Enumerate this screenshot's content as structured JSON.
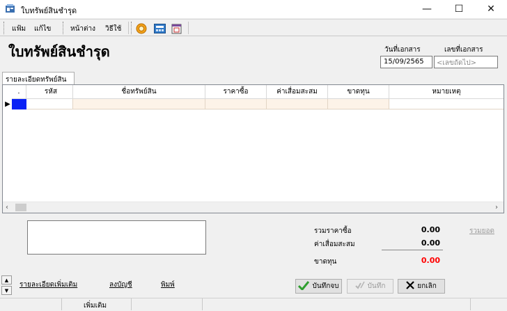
{
  "window": {
    "title": "ใบทรัพย์สินชำรุด",
    "minimize_glyph": "—",
    "maximize_glyph": "☐",
    "close_glyph": "✕"
  },
  "toolbar": {
    "menu": [
      "แฟ้ม",
      "แก้ไข",
      "หน้าต่าง",
      "วิธีใช้"
    ],
    "icons": [
      "help-disc-icon",
      "calculator-icon",
      "calendar-icon"
    ]
  },
  "header": {
    "heading": "ใบทรัพย์สินชำรุด",
    "date_label": "วันที่เอกสาร",
    "date_value": "15/09/2565",
    "docno_label": "เลขที่เอกสาร",
    "docno_placeholder": "<เลขถัดไป>"
  },
  "tab": {
    "label": "รายละเอียดทรัพย์สิน"
  },
  "grid": {
    "columns": [
      ".",
      "รหัส",
      "ชื่อทรัพย์สิน",
      "ราคาซื้อ",
      "ค่าเสื่อมสะสม",
      "ขาดทุน",
      "หมายเหตุ"
    ],
    "row_marker": "▶"
  },
  "summary": {
    "purchase_label": "รวมราคาซื้อ",
    "purchase_value": "0.00",
    "depreciation_label": "ค่าเสื่อมสะสม",
    "depreciation_value": "0.00",
    "loss_label": "ขาดทุน",
    "loss_value": "0.00",
    "total_link": "รวมยอด"
  },
  "links": {
    "more_details": "รายละเอียดเพิ่มเติม",
    "post_account": "ลงบัญชี",
    "print": "พิมพ์"
  },
  "buttons": {
    "save_close": "บันทึกจบ",
    "save": "บันทึก",
    "cancel": "ยกเลิก"
  },
  "statusbar": {
    "mode": "เพิ่มเติม"
  },
  "colors": {
    "selection": "#0a22f5",
    "loss": "#ff0000",
    "row_fill": "#fdf3e8",
    "ok_green": "#2e9e2e",
    "disabled_text": "#9a9a9a"
  }
}
